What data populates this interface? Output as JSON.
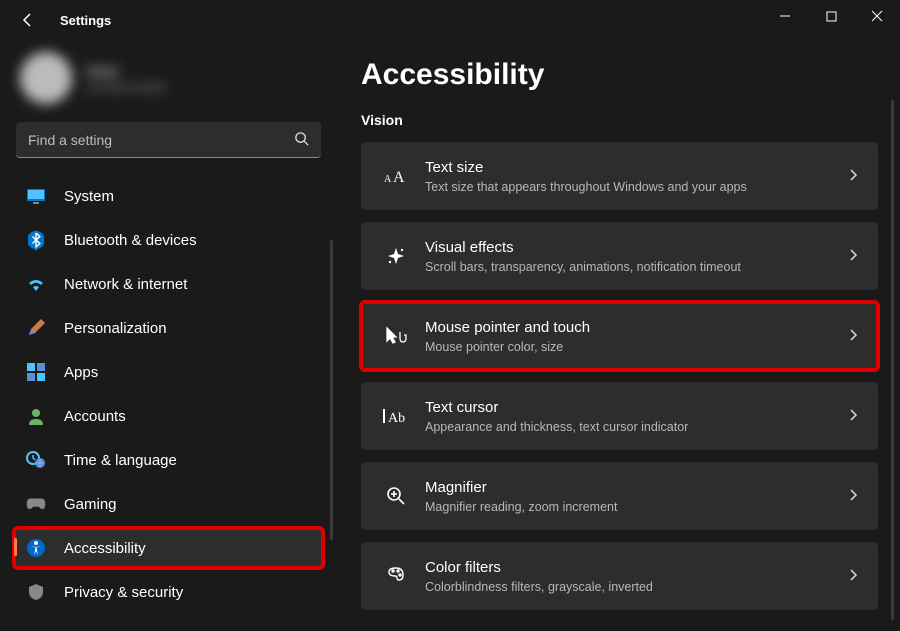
{
  "app_title": "Settings",
  "profile": {
    "name": "User",
    "email": "user@example"
  },
  "search": {
    "placeholder": "Find a setting"
  },
  "nav": [
    {
      "key": "system",
      "label": "System"
    },
    {
      "key": "bluetooth",
      "label": "Bluetooth & devices"
    },
    {
      "key": "network",
      "label": "Network & internet"
    },
    {
      "key": "personalization",
      "label": "Personalization"
    },
    {
      "key": "apps",
      "label": "Apps"
    },
    {
      "key": "accounts",
      "label": "Accounts"
    },
    {
      "key": "time",
      "label": "Time & language"
    },
    {
      "key": "gaming",
      "label": "Gaming"
    },
    {
      "key": "accessibility",
      "label": "Accessibility"
    },
    {
      "key": "privacy",
      "label": "Privacy & security"
    }
  ],
  "active_nav_key": "accessibility",
  "highlight_nav_key": "accessibility",
  "page": {
    "title": "Accessibility",
    "section": "Vision",
    "items": [
      {
        "key": "text-size",
        "title": "Text size",
        "desc": "Text size that appears throughout Windows and your apps"
      },
      {
        "key": "visual-effects",
        "title": "Visual effects",
        "desc": "Scroll bars, transparency, animations, notification timeout"
      },
      {
        "key": "mouse-pointer",
        "title": "Mouse pointer and touch",
        "desc": "Mouse pointer color, size",
        "highlight": true
      },
      {
        "key": "text-cursor",
        "title": "Text cursor",
        "desc": "Appearance and thickness, text cursor indicator"
      },
      {
        "key": "magnifier",
        "title": "Magnifier",
        "desc": "Magnifier reading, zoom increment"
      },
      {
        "key": "color-filters",
        "title": "Color filters",
        "desc": "Colorblindness filters, grayscale, inverted"
      }
    ]
  },
  "icons": {
    "system": "monitor",
    "bluetooth": "bluetooth",
    "network": "wifi",
    "personalization": "brush",
    "apps": "apps",
    "accounts": "person",
    "time": "clock-globe",
    "gaming": "gamepad",
    "accessibility": "accessibility",
    "privacy": "shield"
  }
}
